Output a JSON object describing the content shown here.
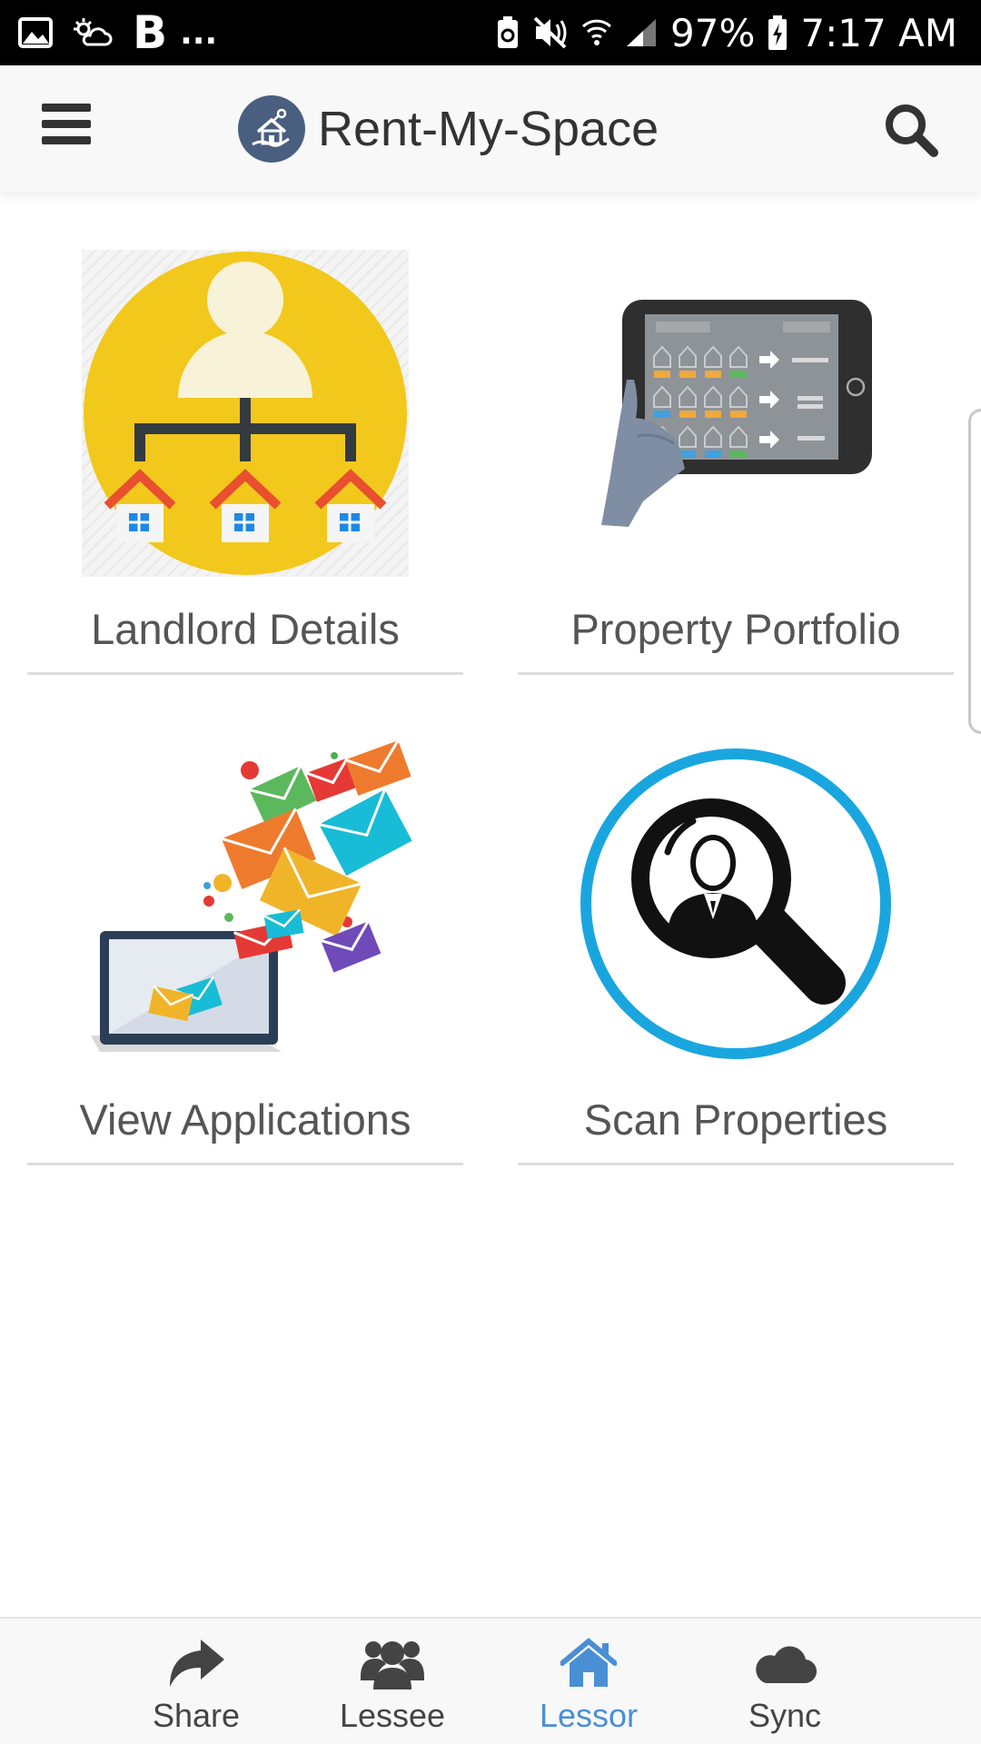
{
  "status_bar": {
    "left_letter": "B",
    "left_more": "...",
    "battery_percent": "97%",
    "time": "7:17 AM",
    "icons": [
      "gallery-icon",
      "weather-icon",
      "battery-saver-icon",
      "mute-vibrate-icon",
      "wifi-icon",
      "signal-icon",
      "battery-charging-icon"
    ]
  },
  "header": {
    "title": "Rent-My-Space",
    "icons": [
      "menu-icon",
      "app-logo",
      "search-icon"
    ]
  },
  "tiles": [
    {
      "label": "Landlord Details",
      "icon": "landlord-network-illustration"
    },
    {
      "label": "Property Portfolio",
      "icon": "tablet-portfolio-illustration"
    },
    {
      "label": "View Applications",
      "icon": "envelopes-laptop-illustration"
    },
    {
      "label": "Scan Properties",
      "icon": "magnifier-person-illustration"
    }
  ],
  "bottom_nav": {
    "items": [
      {
        "label": "Share",
        "icon": "share-icon",
        "active": false
      },
      {
        "label": "Lessee",
        "icon": "users-icon",
        "active": false
      },
      {
        "label": "Lessor",
        "icon": "home-icon",
        "active": true
      },
      {
        "label": "Sync",
        "icon": "cloud-icon",
        "active": false
      }
    ]
  },
  "colors": {
    "accent": "#4a8fd4",
    "header_bg": "#f8f8f8",
    "status_bar_bg": "#000000",
    "landlord_yellow": "#f2c81c",
    "scan_ring_blue": "#19a6df"
  }
}
